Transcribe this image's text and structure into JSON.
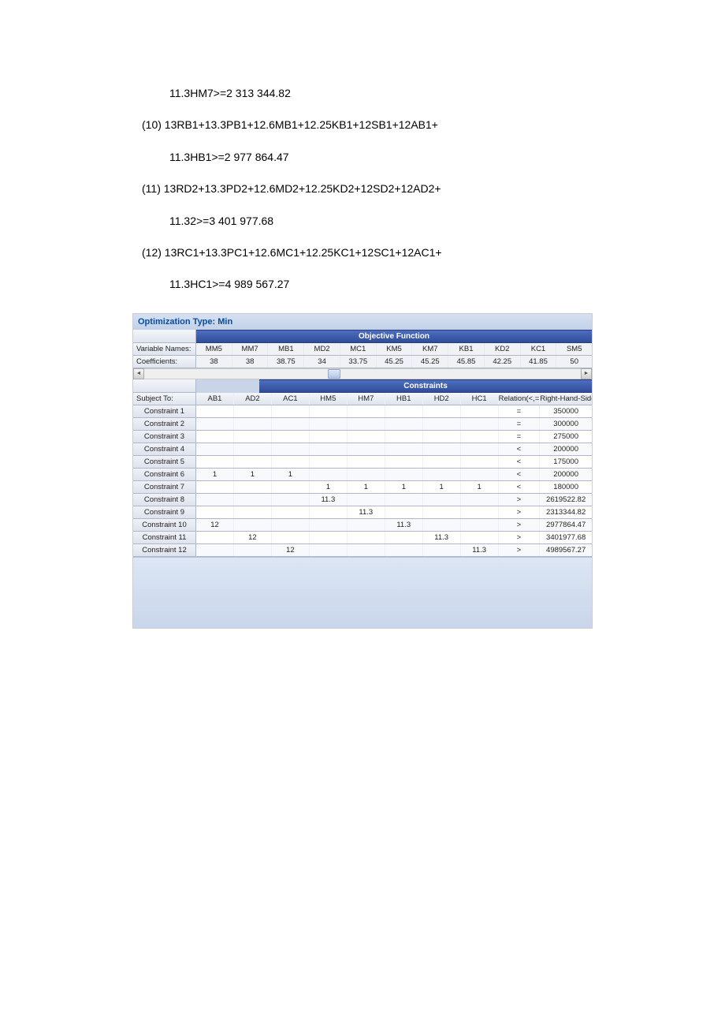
{
  "equations": [
    {
      "indent": true,
      "text": "11.3HM7>=2 313 344.82"
    },
    {
      "indent": false,
      "text": "(10)  13RB1+13.3PB1+12.6MB1+12.25KB1+12SB1+12AB1+"
    },
    {
      "indent": true,
      "text": "11.3HB1>=2 977 864.47"
    },
    {
      "indent": false,
      "text": "(11)  13RD2+13.3PD2+12.6MD2+12.25KD2+12SD2+12AD2+"
    },
    {
      "indent": true,
      "text": "11.32>=3 401 977.68"
    },
    {
      "indent": false,
      "text": "(12)  13RC1+13.3PC1+12.6MC1+12.25KC1+12SC1+12AC1+"
    },
    {
      "indent": true,
      "text": "11.3HC1>=4 989 567.27"
    }
  ],
  "app": {
    "title": "Optimization Type:  Min",
    "obj_title": "Objective Function",
    "con_title": "Constraints",
    "var_row_label": "Variable Names:",
    "coef_row_label": "Coefficients:",
    "subject_to_label": "Subject To:",
    "relation_header": "Relation(<,=,>)",
    "rhs_header": "Right-Hand-Side",
    "obj_vars": [
      "MM5",
      "MM7",
      "MB1",
      "MD2",
      "MC1",
      "KM5",
      "KM7",
      "KB1",
      "KD2",
      "KC1",
      "SM5"
    ],
    "obj_coefs": [
      "38",
      "38",
      "38.75",
      "34",
      "33.75",
      "45.25",
      "45.25",
      "45.85",
      "42.25",
      "41.85",
      "50"
    ],
    "con_vars": [
      "AB1",
      "AD2",
      "AC1",
      "HM5",
      "HM7",
      "HB1",
      "HD2",
      "HC1"
    ],
    "constraints": [
      {
        "name": "Constraint 1",
        "vals": [
          "",
          "",
          "",
          "",
          "",
          "",
          "",
          ""
        ],
        "rel": "=",
        "rhs": "350000"
      },
      {
        "name": "Constraint 2",
        "vals": [
          "",
          "",
          "",
          "",
          "",
          "",
          "",
          ""
        ],
        "rel": "=",
        "rhs": "300000"
      },
      {
        "name": "Constraint 3",
        "vals": [
          "",
          "",
          "",
          "",
          "",
          "",
          "",
          ""
        ],
        "rel": "=",
        "rhs": "275000"
      },
      {
        "name": "Constraint 4",
        "vals": [
          "",
          "",
          "",
          "",
          "",
          "",
          "",
          ""
        ],
        "rel": "<",
        "rhs": "200000"
      },
      {
        "name": "Constraint 5",
        "vals": [
          "",
          "",
          "",
          "",
          "",
          "",
          "",
          ""
        ],
        "rel": "<",
        "rhs": "175000"
      },
      {
        "name": "Constraint 6",
        "vals": [
          "1",
          "1",
          "1",
          "",
          "",
          "",
          "",
          ""
        ],
        "rel": "<",
        "rhs": "200000"
      },
      {
        "name": "Constraint 7",
        "vals": [
          "",
          "",
          "",
          "1",
          "1",
          "1",
          "1",
          "1"
        ],
        "rel": "<",
        "rhs": "180000"
      },
      {
        "name": "Constraint 8",
        "vals": [
          "",
          "",
          "",
          "11.3",
          "",
          "",
          "",
          ""
        ],
        "rel": ">",
        "rhs": "2619522.82"
      },
      {
        "name": "Constraint 9",
        "vals": [
          "",
          "",
          "",
          "",
          "11.3",
          "",
          "",
          ""
        ],
        "rel": ">",
        "rhs": "2313344.82"
      },
      {
        "name": "Constraint 10",
        "vals": [
          "12",
          "",
          "",
          "",
          "",
          "11.3",
          "",
          ""
        ],
        "rel": ">",
        "rhs": "2977864.47"
      },
      {
        "name": "Constraint 11",
        "vals": [
          "",
          "12",
          "",
          "",
          "",
          "",
          "11.3",
          ""
        ],
        "rel": ">",
        "rhs": "3401977.68"
      },
      {
        "name": "Constraint 12",
        "vals": [
          "",
          "",
          "12",
          "",
          "",
          "",
          "",
          "11.3"
        ],
        "rel": ">",
        "rhs": "4989567.27"
      }
    ]
  }
}
